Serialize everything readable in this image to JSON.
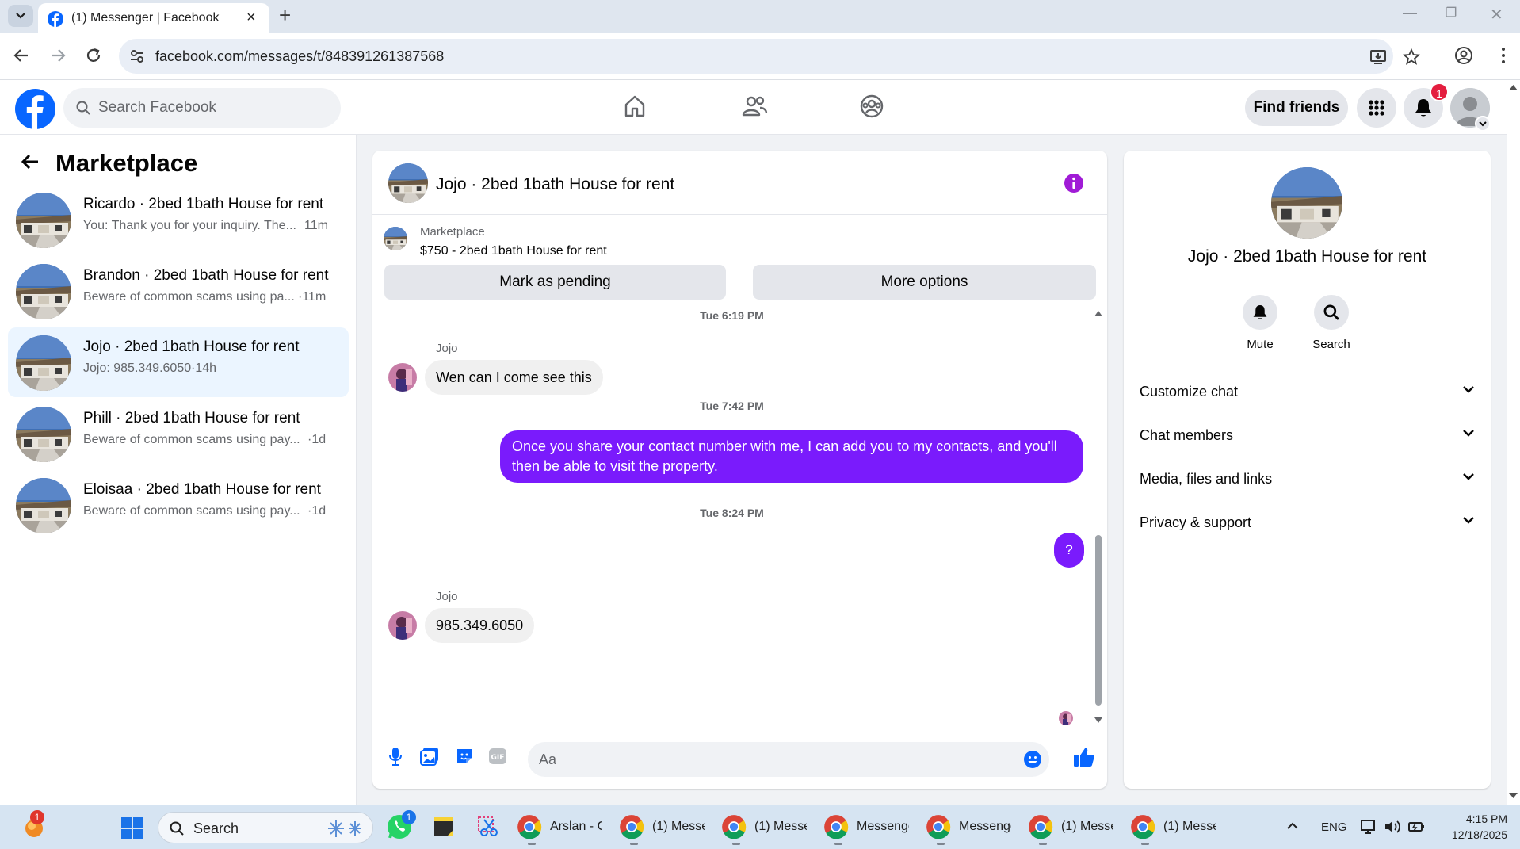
{
  "browser": {
    "tab_title": "(1) Messenger | Facebook",
    "url": "facebook.com/messages/t/848391261387568"
  },
  "fb_header": {
    "search_placeholder": "Search Facebook",
    "find_friends": "Find friends",
    "notification_count": "1"
  },
  "left_panel": {
    "title": "Marketplace",
    "conversations": [
      {
        "name": "Ricardo · 2bed 1bath House for rent",
        "preview": "You: Thank you for your inquiry. The...",
        "time": "11m"
      },
      {
        "name": "Brandon · 2bed 1bath House for rent",
        "preview": "Beware of common scams using pa...",
        "time": "·11m"
      },
      {
        "name": "Jojo · 2bed 1bath House for rent",
        "preview": "Jojo: 985.349.6050",
        "time": "·14h"
      },
      {
        "name": "Phill · 2bed 1bath House for rent",
        "preview": "Beware of common scams using pay...",
        "time": "·1d"
      },
      {
        "name": "Eloisaa · 2bed 1bath House for rent",
        "preview": "Beware of common scams using pay...",
        "time": "·1d"
      }
    ]
  },
  "chat": {
    "title": "Jojo · 2bed 1bath House for rent",
    "marketplace_label": "Marketplace",
    "listing": "$750 - 2bed 1bath House for rent",
    "mark_pending": "Mark as pending",
    "more_options": "More options",
    "messages": [
      {
        "timestamp": "Tue 6:19 PM"
      },
      {
        "sender": "Jojo",
        "text": "Wen can I come see this"
      },
      {
        "timestamp": "Tue 7:42 PM"
      },
      {
        "text": "Once you share your contact number with me, I can add you to my contacts, and you'll then be able to visit the property."
      },
      {
        "timestamp": "Tue 8:24 PM"
      },
      {
        "text": "?"
      },
      {
        "sender": "Jojo",
        "text": "985.349.6050"
      }
    ],
    "input_placeholder": "Aa",
    "accent_color": "#7a1bfc"
  },
  "right_panel": {
    "title": "Jojo · 2bed 1bath House for rent",
    "mute": "Mute",
    "search": "Search",
    "sections": [
      "Customize chat",
      "Chat members",
      "Media, files and links",
      "Privacy & support"
    ]
  },
  "taskbar": {
    "search": "Search",
    "apps": [
      "Arslan - G",
      "(1) Messe",
      "(1) Messe",
      "Messenge",
      "Messenge",
      "(1) Messe",
      "(1) Messe"
    ],
    "lang": "ENG",
    "time": "4:15 PM",
    "date": "12/18/2025",
    "whatsapp_badge": "1",
    "widget_badge": "1"
  }
}
